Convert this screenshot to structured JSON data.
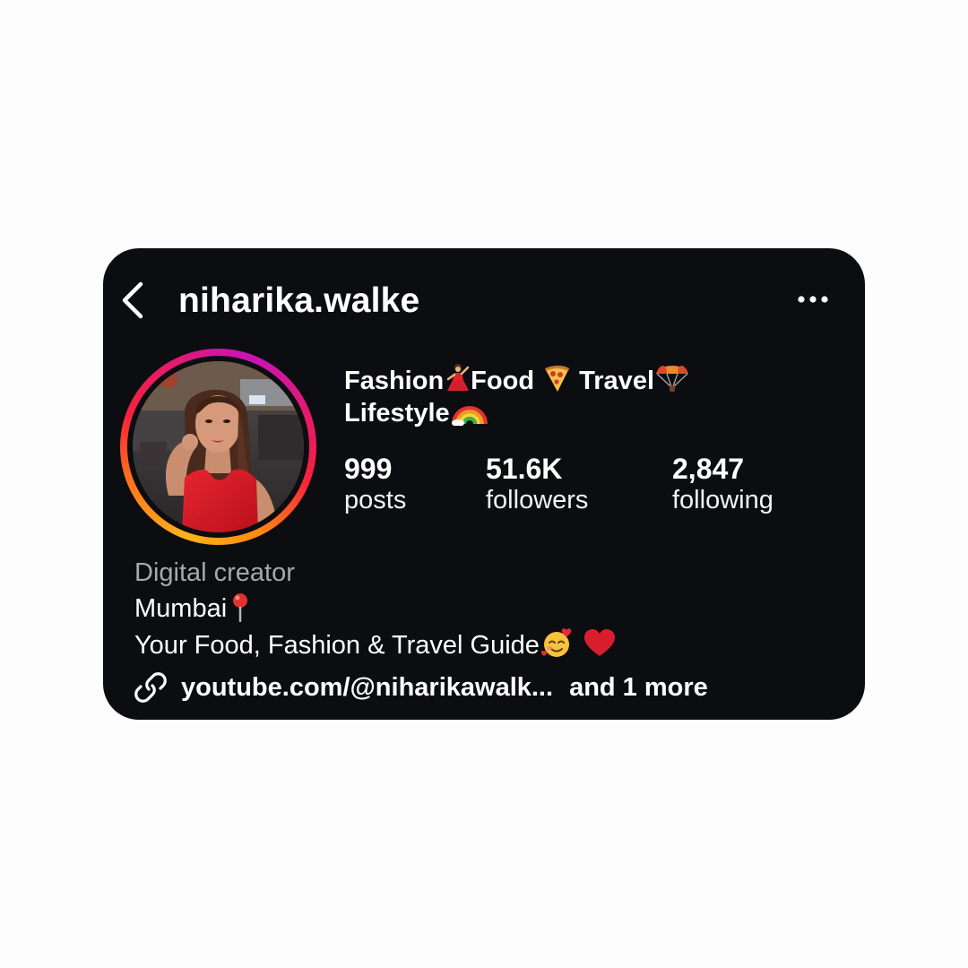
{
  "profile": {
    "username": "niharika.walke",
    "headline_line1_parts": [
      "Fashion",
      "Food",
      "Travel"
    ],
    "headline_line2": "Lifestyle",
    "category": "Digital creator",
    "bio_location": "Mumbai",
    "bio_tagline": "Your Food, Fashion & Travel Guide",
    "link_text": "youtube.com/@niharikawalk...",
    "link_more": "and 1 more"
  },
  "stats": {
    "posts_value": "999",
    "posts_label": "posts",
    "followers_value": "51.6K",
    "followers_label": "followers",
    "following_value": "2,847",
    "following_label": "following"
  },
  "icons": {
    "back": "chevron-left-icon",
    "more": "ellipsis-icon",
    "link": "link-icon",
    "emojis": [
      "dancer-emoji",
      "pizza-emoji",
      "parachute-emoji",
      "rainbow-emoji",
      "pin-emoji",
      "smiling-hearts-emoji",
      "red-heart-emoji"
    ]
  },
  "colors": {
    "background": "#0c0d11",
    "text": "#ffffff",
    "secondary_text": "#a6a8ae",
    "story_ring": [
      "#ffb21f",
      "#f5213c",
      "#c913b9"
    ]
  }
}
